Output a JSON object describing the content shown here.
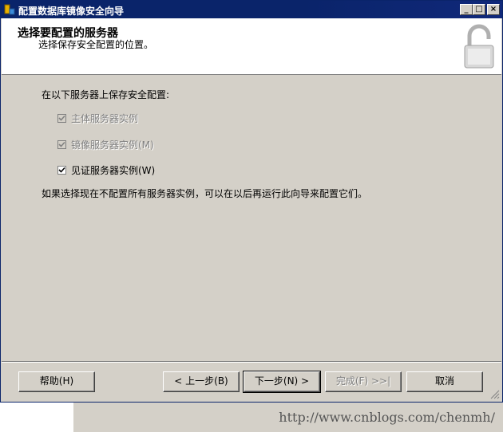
{
  "window": {
    "title": "配置数据库镜像安全向导",
    "controls": {
      "minimize": "_",
      "maximize": "□",
      "close": "×"
    }
  },
  "header": {
    "title": "选择要配置的服务器",
    "subtitle": "选择保存安全配置的位置。",
    "icon": "padlock-open-icon"
  },
  "content": {
    "label": "在以下服务器上保存安全配置:",
    "checkboxes": [
      {
        "label": "主体服务器实例",
        "checked": true,
        "enabled": false
      },
      {
        "label": "镜像服务器实例(M)",
        "checked": true,
        "enabled": false
      },
      {
        "label": "见证服务器实例(W)",
        "checked": true,
        "enabled": true
      }
    ],
    "note": "如果选择现在不配置所有服务器实例，可以在以后再运行此向导来配置它们。"
  },
  "footer": {
    "help": "帮助(H)",
    "back": "< 上一步(B)",
    "next": "下一步(N) >",
    "finish": "完成(F) >>|",
    "cancel": "取消"
  },
  "watermark": "http://www.cnblogs.com/chenmh/"
}
